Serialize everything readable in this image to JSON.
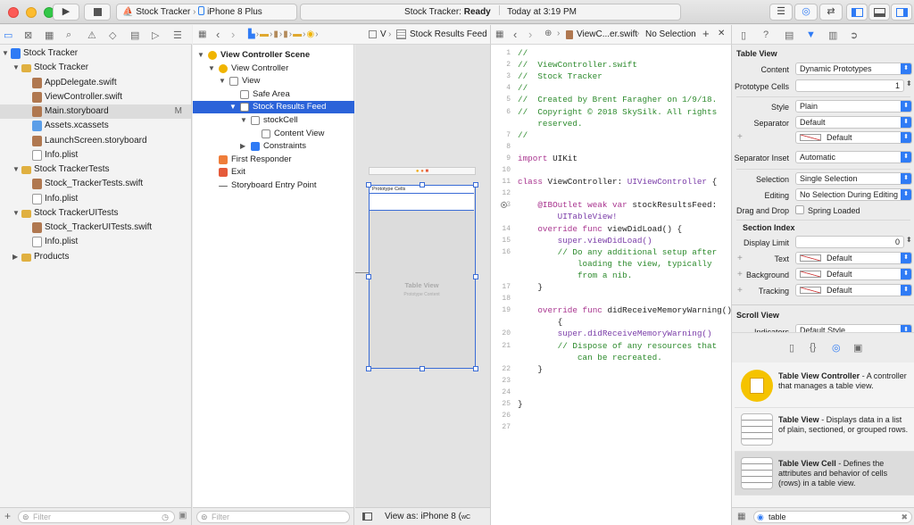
{
  "toolbar": {
    "scheme_app": "Stock Tracker",
    "scheme_device": "iPhone 8 Plus",
    "status_prefix": "Stock Tracker: ",
    "status_state": "Ready",
    "status_time": "Today at 3:19 PM"
  },
  "navigator": {
    "items": [
      {
        "label": "Stock Tracker",
        "kind": "project",
        "level": 0,
        "open": true,
        "badge": ""
      },
      {
        "label": "Stock Tracker",
        "kind": "folder",
        "level": 1,
        "open": true,
        "badge": ""
      },
      {
        "label": "AppDelegate.swift",
        "kind": "swift",
        "level": 2,
        "badge": ""
      },
      {
        "label": "ViewController.swift",
        "kind": "swift",
        "level": 2,
        "badge": ""
      },
      {
        "label": "Main.storyboard",
        "kind": "storyboard",
        "level": 2,
        "badge": "M",
        "selected": true
      },
      {
        "label": "Assets.xcassets",
        "kind": "assets",
        "level": 2,
        "badge": ""
      },
      {
        "label": "LaunchScreen.storyboard",
        "kind": "storyboard",
        "level": 2,
        "badge": ""
      },
      {
        "label": "Info.plist",
        "kind": "plist",
        "level": 2,
        "badge": ""
      },
      {
        "label": "Stock TrackerTests",
        "kind": "folder",
        "level": 1,
        "open": true,
        "badge": ""
      },
      {
        "label": "Stock_TrackerTests.swift",
        "kind": "swift",
        "level": 2,
        "badge": ""
      },
      {
        "label": "Info.plist",
        "kind": "plist",
        "level": 2,
        "badge": ""
      },
      {
        "label": "Stock TrackerUITests",
        "kind": "folder",
        "level": 1,
        "open": true,
        "badge": ""
      },
      {
        "label": "Stock_TrackerUITests.swift",
        "kind": "swift",
        "level": 2,
        "badge": ""
      },
      {
        "label": "Info.plist",
        "kind": "plist",
        "level": 2,
        "badge": ""
      },
      {
        "label": "Products",
        "kind": "folder",
        "level": 1,
        "open": false,
        "badge": ""
      }
    ],
    "filter_placeholder": "Filter"
  },
  "outline": {
    "jump_v": "V",
    "jump_current": "Stock Results Feed",
    "items": [
      {
        "label": "View Controller Scene",
        "kind": "scene",
        "level": 0,
        "disc": "open",
        "bold": true
      },
      {
        "label": "View Controller",
        "kind": "vc",
        "level": 1,
        "disc": "open"
      },
      {
        "label": "View",
        "kind": "view",
        "level": 2,
        "disc": "open"
      },
      {
        "label": "Safe Area",
        "kind": "view",
        "level": 3,
        "disc": ""
      },
      {
        "label": "Stock Results Feed",
        "kind": "table",
        "level": 3,
        "disc": "open",
        "selected": true
      },
      {
        "label": "stockCell",
        "kind": "cell",
        "level": 4,
        "disc": "open"
      },
      {
        "label": "Content View",
        "kind": "view",
        "level": 5,
        "disc": ""
      },
      {
        "label": "Constraints",
        "kind": "constraints",
        "level": 4,
        "disc": "closed"
      },
      {
        "label": "First Responder",
        "kind": "responder",
        "level": 1,
        "disc": ""
      },
      {
        "label": "Exit",
        "kind": "exit",
        "level": 1,
        "disc": ""
      },
      {
        "label": "Storyboard Entry Point",
        "kind": "arrow",
        "level": 1,
        "disc": ""
      }
    ],
    "filter_placeholder": "Filter"
  },
  "canvas": {
    "prototype_cells": "Prototype Cells",
    "table_title": "Table View",
    "table_sub": "Prototype Content",
    "view_as": "View as: iPhone 8 (",
    "view_as_suffix": "wC"
  },
  "editor": {
    "file": "ViewC...er.swift",
    "selection": "No Selection",
    "lines": [
      {
        "n": "1",
        "t": "//",
        "c": "cm"
      },
      {
        "n": "2",
        "t": "//  ViewController.swift",
        "c": "cm"
      },
      {
        "n": "3",
        "t": "//  Stock Tracker",
        "c": "cm"
      },
      {
        "n": "4",
        "t": "//",
        "c": "cm"
      },
      {
        "n": "5",
        "t": "//  Created by Brent Faragher on 1/9/18.",
        "c": "cm"
      },
      {
        "n": "6",
        "t": "//  Copyright © 2018 SkySilk. All rights",
        "c": "cm"
      },
      {
        "n": "",
        "t": "    reserved.",
        "c": "cm"
      },
      {
        "n": "7",
        "t": "//",
        "c": "cm"
      },
      {
        "n": "8",
        "t": "",
        "c": ""
      },
      {
        "n": "9",
        "t": "import UIKit",
        "c": "import"
      },
      {
        "n": "10",
        "t": "",
        "c": ""
      },
      {
        "n": "11",
        "t": "class ViewController: UIViewController {",
        "c": "class"
      },
      {
        "n": "12",
        "t": "",
        "c": ""
      },
      {
        "n": "13",
        "t": "    @IBOutlet weak var stockResultsFeed:",
        "c": "outlet"
      },
      {
        "n": "",
        "t": "        UITableView!",
        "c": "ty"
      },
      {
        "n": "14",
        "t": "    override func viewDidLoad() {",
        "c": "func"
      },
      {
        "n": "15",
        "t": "        super.viewDidLoad()",
        "c": "super"
      },
      {
        "n": "16",
        "t": "        // Do any additional setup after",
        "c": "cm"
      },
      {
        "n": "",
        "t": "            loading the view, typically",
        "c": "cm"
      },
      {
        "n": "",
        "t": "            from a nib.",
        "c": "cm"
      },
      {
        "n": "17",
        "t": "    }",
        "c": ""
      },
      {
        "n": "18",
        "t": "",
        "c": ""
      },
      {
        "n": "19",
        "t": "    override func didReceiveMemoryWarning()",
        "c": "func"
      },
      {
        "n": "",
        "t": "        {",
        "c": ""
      },
      {
        "n": "20",
        "t": "        super.didReceiveMemoryWarning()",
        "c": "super"
      },
      {
        "n": "21",
        "t": "        // Dispose of any resources that",
        "c": "cm"
      },
      {
        "n": "",
        "t": "            can be recreated.",
        "c": "cm"
      },
      {
        "n": "22",
        "t": "    }",
        "c": ""
      },
      {
        "n": "23",
        "t": "",
        "c": ""
      },
      {
        "n": "24",
        "t": "",
        "c": ""
      },
      {
        "n": "25",
        "t": "}",
        "c": ""
      },
      {
        "n": "26",
        "t": "",
        "c": ""
      },
      {
        "n": "27",
        "t": "",
        "c": ""
      }
    ]
  },
  "inspector": {
    "section_title": "Table View",
    "content_label": "Content",
    "content_value": "Dynamic Prototypes",
    "prototype_label": "Prototype Cells",
    "prototype_value": "1",
    "style_label": "Style",
    "style_value": "Plain",
    "separator_label": "Separator",
    "separator_value": "Default",
    "separator_color": "Default",
    "inset_label": "Separator Inset",
    "inset_value": "Automatic",
    "selection_label": "Selection",
    "selection_value": "Single Selection",
    "editing_label": "Editing",
    "editing_value": "No Selection During Editing",
    "dragdrop_label": "Drag and Drop",
    "dragdrop_value": "Spring Loaded",
    "section_index": "Section Index",
    "display_limit_label": "Display Limit",
    "display_limit_value": "0",
    "text_label": "Text",
    "text_value": "Default",
    "background_label": "Background",
    "background_value": "Default",
    "tracking_label": "Tracking",
    "tracking_value": "Default",
    "scroll_view": "Scroll View",
    "indicators_label": "Indicators",
    "indicators_value": "Default Style"
  },
  "library": {
    "items": [
      {
        "title": "Table View Controller",
        "desc": " - A controller that manages a table view.",
        "thumb": "yellow"
      },
      {
        "title": "Table View",
        "desc": " - Displays data in a list of plain, sectioned, or grouped rows.",
        "thumb": "gray"
      },
      {
        "title": "Table View Cell",
        "desc": " - Defines the attributes and behavior of cells (rows) in a table view.",
        "thumb": "gray"
      }
    ],
    "search_value": "table"
  },
  "colors": {
    "accent": "#2b63d9",
    "comment": "#2c8a2c",
    "keyword": "#a8338e",
    "type": "#7a3ca8"
  }
}
